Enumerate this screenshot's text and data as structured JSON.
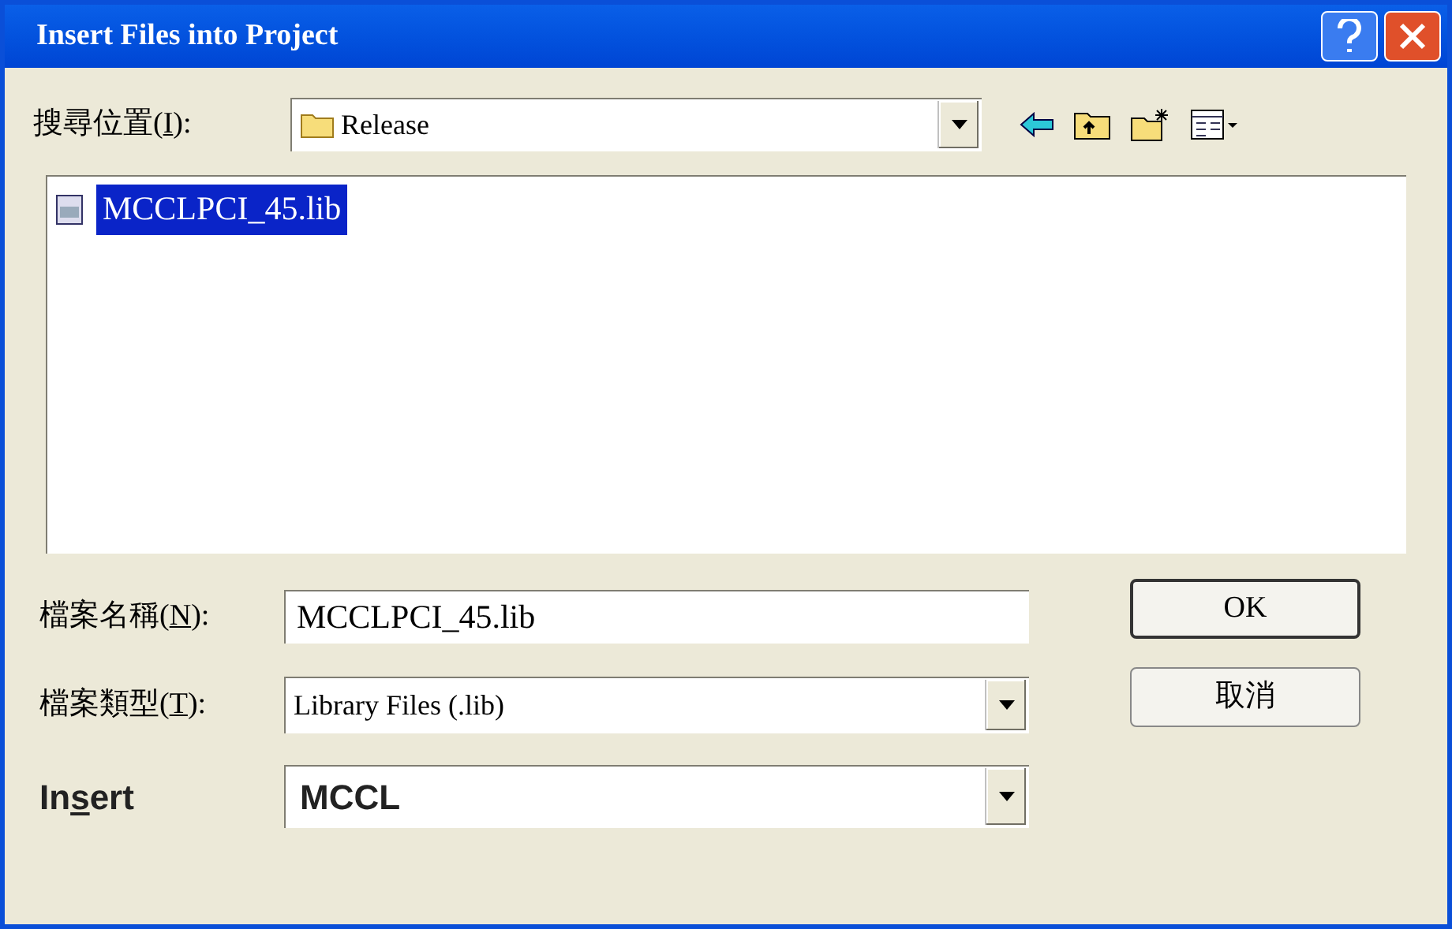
{
  "window": {
    "title": "Insert Files into Project"
  },
  "look_in": {
    "label_parts": [
      "搜尋位置(",
      "I",
      "):"
    ],
    "value": "Release"
  },
  "files": [
    {
      "name": "MCCLPCI_45.lib",
      "selected": true
    }
  ],
  "file_name": {
    "label_parts": [
      "檔案名稱(",
      "N",
      "):"
    ],
    "value": "MCCLPCI_45.lib"
  },
  "file_type": {
    "label_parts": [
      "檔案類型(",
      "T",
      "):"
    ],
    "value": "Library Files (.lib)"
  },
  "insert": {
    "label_parts": [
      "In",
      "s",
      "ert"
    ],
    "value": "MCCL"
  },
  "buttons": [
    "OK",
    "取消"
  ]
}
